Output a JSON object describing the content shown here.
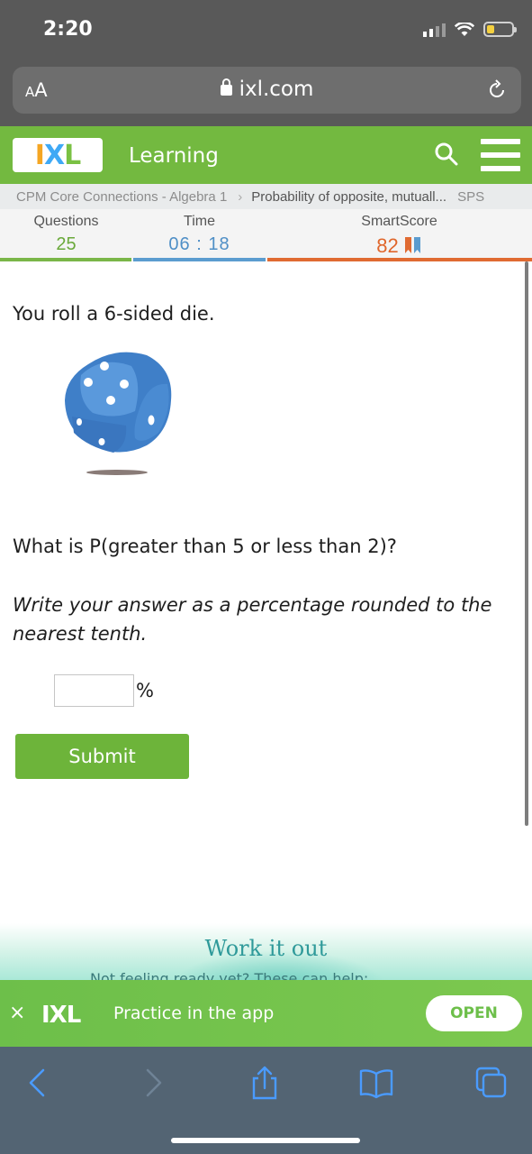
{
  "status_bar": {
    "time": "2:20"
  },
  "browser": {
    "text_size_label": "AA",
    "url": "ixl.com"
  },
  "header": {
    "logo_text": "IXL",
    "section": "Learning"
  },
  "breadcrumb": {
    "course": "CPM Core Connections - Algebra 1",
    "skill": "Probability of opposite, mutuall...",
    "code": "SPS"
  },
  "stats": {
    "questions_label": "Questions",
    "questions_value": "25",
    "time_label": "Time",
    "time_value": "06 : 18",
    "smartscore_label": "SmartScore",
    "smartscore_value": "82"
  },
  "question": {
    "prompt": "You roll a 6-sided die.",
    "main": "What is P(greater than 5 or less than 2)?",
    "instruction": "Write your answer as a percentage rounded to the nearest tenth.",
    "answer_value": "",
    "unit": "%",
    "submit_label": "Submit"
  },
  "promo": {
    "title": "Work it out",
    "subtitle": "Not feeling ready yet? These can help:"
  },
  "app_banner": {
    "close": "×",
    "logo_text": "IXL",
    "text": "Practice in the app",
    "open_label": "OPEN"
  },
  "colors": {
    "brand_green": "#73b940",
    "time_blue": "#4f8fc6",
    "score_orange": "#e0662b",
    "toolbar": "#536473"
  }
}
